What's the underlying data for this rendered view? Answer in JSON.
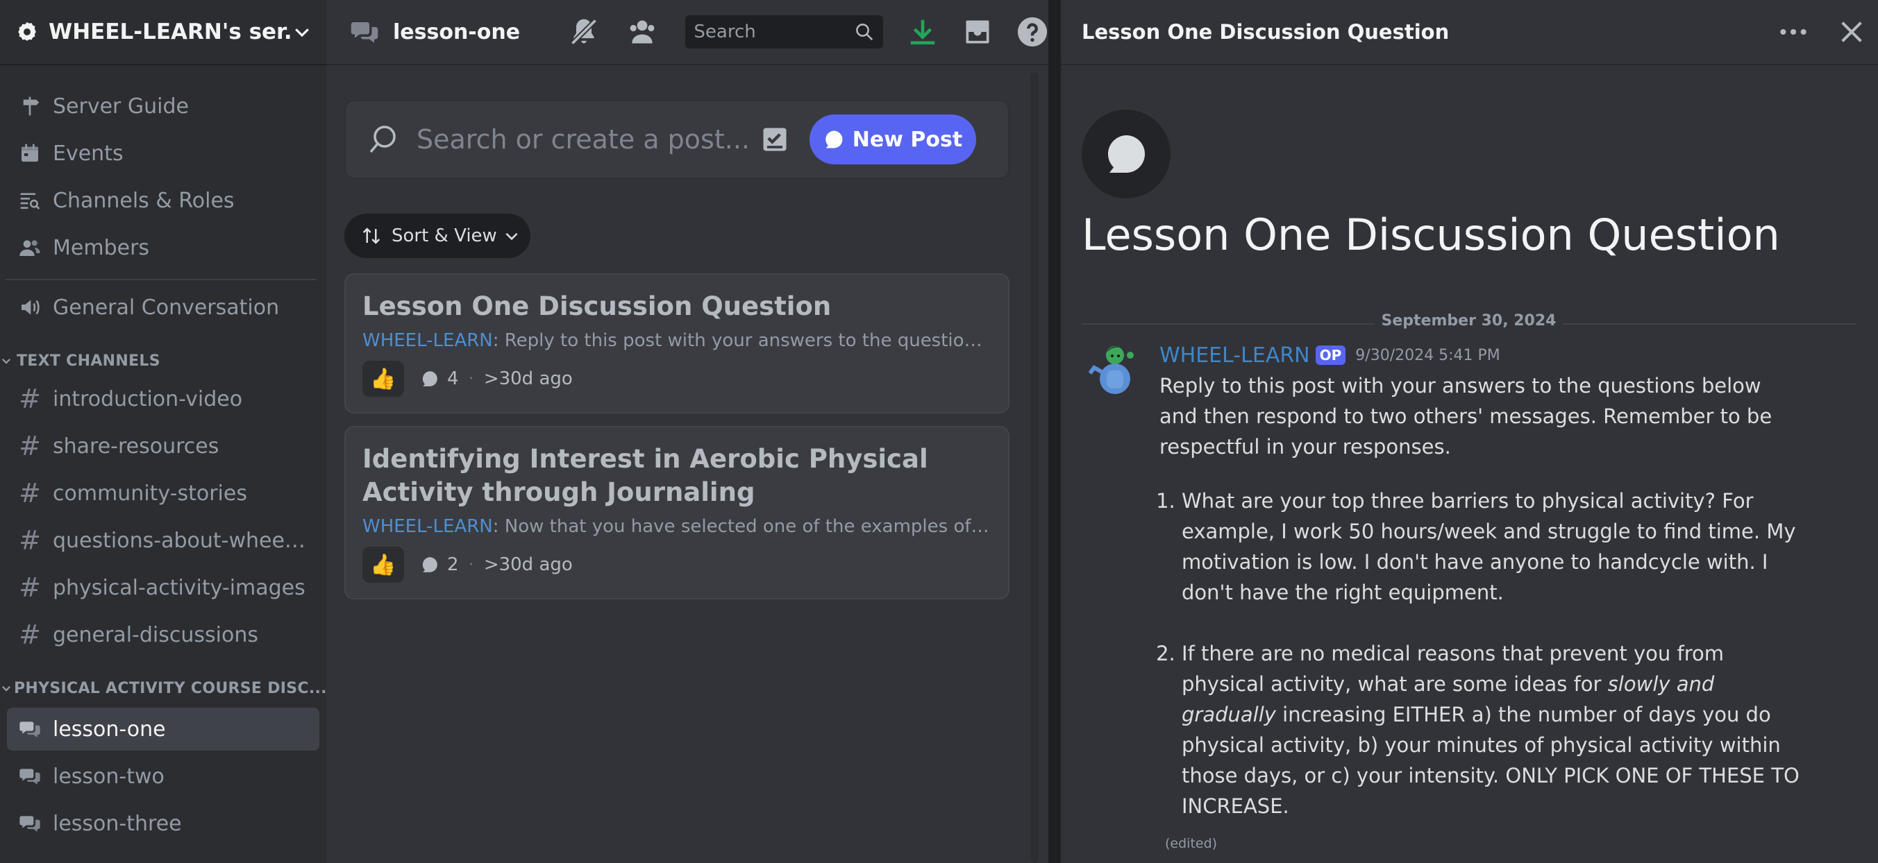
{
  "server": {
    "name": "WHEEL-LEARN's ser..."
  },
  "sidebar": {
    "nav": [
      {
        "label": "Server Guide",
        "icon": "signpost-icon"
      },
      {
        "label": "Events",
        "icon": "calendar-icon"
      },
      {
        "label": "Channels & Roles",
        "icon": "channels-roles-icon"
      },
      {
        "label": "Members",
        "icon": "members-icon"
      }
    ],
    "voice_channel": "General Conversation",
    "text_category": "TEXT CHANNELS",
    "text_channels": [
      "introduction-video",
      "share-resources",
      "community-stories",
      "questions-about-wheel-...",
      "physical-activity-images",
      "general-discussions"
    ],
    "forum_category": "PHYSICAL ACTIVITY COURSE DISC...",
    "forum_channels": [
      "lesson-one",
      "lesson-two",
      "lesson-three"
    ]
  },
  "forum": {
    "channel_name": "lesson-one",
    "search_placeholder": "Search",
    "post_search_placeholder": "Search or create a post...",
    "new_post_label": "New Post",
    "sort_label": "Sort & View",
    "posts": [
      {
        "title": "Lesson One Discussion Question",
        "author": "WHEEL-LEARN",
        "preview": ": Reply to this post with your answers to the questions bel...",
        "reaction": "👍",
        "replies": "4",
        "age": ">30d ago"
      },
      {
        "title": "Identifying Interest in Aerobic Physical Activity through Journaling",
        "author": "WHEEL-LEARN",
        "preview": ": Now that you have selected one of the examples of inclu...",
        "reaction": "👍",
        "replies": "2",
        "age": ">30d ago"
      }
    ]
  },
  "thread": {
    "header_title": "Lesson One Discussion Question",
    "title": "Lesson One Discussion Question",
    "date_divider": "September 30, 2024",
    "message": {
      "author": "WHEEL-LEARN",
      "op_badge": "OP",
      "timestamp": "9/30/2024 5:41 PM",
      "intro": "Reply to this post with your answers to the questions below and then respond to two others' messages. Remember to be respectful in your responses.",
      "q1": "What are your top three barriers to physical activity? For example, I work 50 hours/week and struggle to find time. My motivation is low. I don't have anyone to handcycle with. I don't have the right equipment.",
      "q2_before": "If there are no medical reasons that prevent you from physical activity, what are some ideas for ",
      "q2_emph": "slowly and gradually",
      "q2_after": " increasing EITHER a) the number of days you do physical activity, b) your minutes of physical activity within those days, or c) your intensity. ONLY PICK ONE OF THESE TO INCREASE.",
      "edited": "(edited)"
    }
  },
  "colors": {
    "accent": "#5865f2",
    "download": "#23a55a",
    "author_link": "#3f86c9"
  }
}
